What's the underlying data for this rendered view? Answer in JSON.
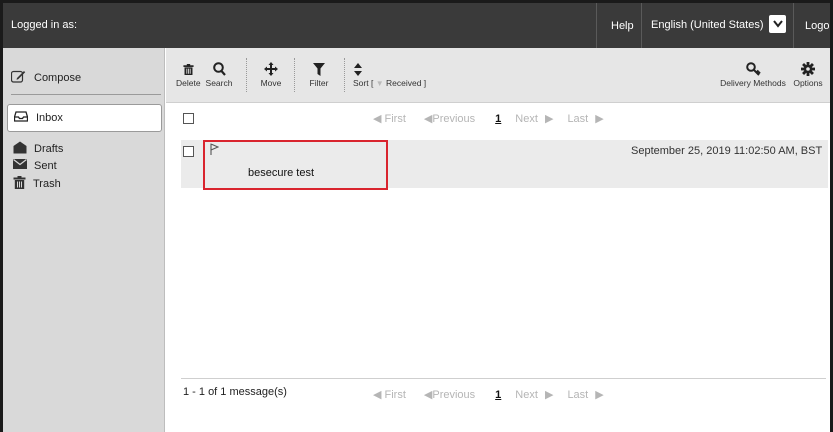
{
  "topbar": {
    "logged_in": "Logged in as:",
    "help": "Help",
    "language": "English (United States)",
    "logout": "Logout"
  },
  "sidebar": {
    "compose": "Compose",
    "items": [
      {
        "label": "Inbox",
        "icon": "inbox-icon"
      },
      {
        "label": "Drafts",
        "icon": "drafts-icon"
      },
      {
        "label": "Sent",
        "icon": "envelope-icon"
      },
      {
        "label": "Trash",
        "icon": "trash-icon"
      }
    ]
  },
  "toolbar": {
    "delete": "Delete",
    "search": "Search",
    "move": "Move",
    "filter": "Filter",
    "sort_label": "Sort [",
    "sort_value": "Received ]",
    "delivery_methods": "Delivery Methods",
    "options": "Options"
  },
  "pager": {
    "first": "First",
    "previous": "Previous",
    "page": "1",
    "next": "Next",
    "last": "Last"
  },
  "messages": [
    {
      "subject": "besecure test",
      "date": "September 25, 2019 11:02:50 AM, BST"
    }
  ],
  "footer": {
    "count": "1 - 1 of 1 message(s)"
  },
  "colors": {
    "topbar": "#3a3a3a",
    "sidebar": "#d9d9d9",
    "highlight": "#d9242e"
  }
}
